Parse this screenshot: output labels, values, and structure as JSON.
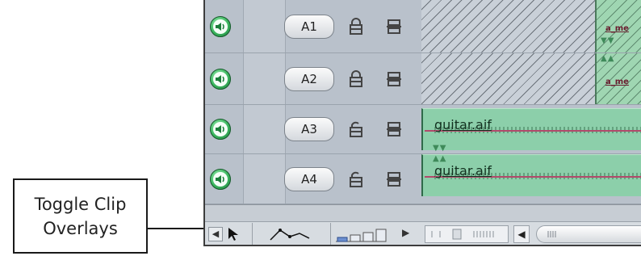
{
  "callout": {
    "text": "Toggle Clip Overlays"
  },
  "tracks": [
    {
      "label": "A1",
      "locked": true,
      "clip": {
        "type": "hatched",
        "name": "a_me"
      }
    },
    {
      "label": "A2",
      "locked": true,
      "clip": {
        "type": "hatched",
        "name": "a_me"
      }
    },
    {
      "label": "A3",
      "locked": false,
      "clip": {
        "type": "audio",
        "name": "guitar.aif"
      }
    },
    {
      "label": "A4",
      "locked": false,
      "clip": {
        "type": "audio",
        "name": "guitar.aif"
      }
    }
  ],
  "colors": {
    "panel_bg": "#b9c1cb",
    "audio_clip": "#8ccfaa",
    "clip_overlay_line": "#b14a6b",
    "speaker_green": "#3bb65f"
  },
  "icons": {
    "speaker": "speaker-icon",
    "lock": "lock-icon",
    "link": "link-icon",
    "toggle_overlays": "clip-overlays-icon",
    "track_height": "track-height-icon"
  }
}
